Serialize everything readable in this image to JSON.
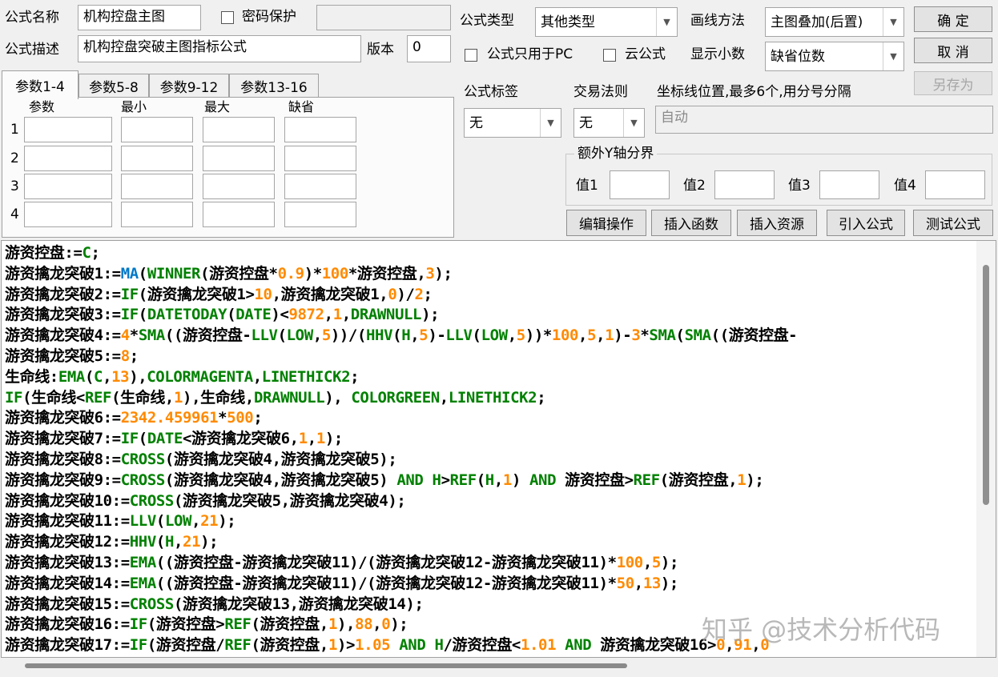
{
  "header": {
    "name_label": "公式名称",
    "name_value": "机构控盘主图",
    "password_label": "密码保护",
    "password_value": "",
    "desc_label": "公式描述",
    "desc_value": "机构控盘突破主图指标公式",
    "version_label": "版本",
    "version_value": "0"
  },
  "options": {
    "type_label": "公式类型",
    "type_value": "其他类型",
    "draw_label": "画线方法",
    "draw_value": "主图叠加(后置)",
    "pc_only_label": "公式只用于PC",
    "cloud_label": "云公式",
    "decimal_label": "显示小数",
    "decimal_value": "缺省位数",
    "tag_label": "公式标签",
    "tag_value": "无",
    "rule_label": "交易法则",
    "rule_value": "无",
    "axis_label": "坐标线位置,最多6个,用分号分隔",
    "axis_value": "自动",
    "yaxis_group": "额外Y轴分界",
    "y1": "值1",
    "y2": "值2",
    "y3": "值3",
    "y4": "值4"
  },
  "buttons": {
    "ok": "确 定",
    "cancel": "取 消",
    "save_as": "另存为",
    "edit": "编辑操作",
    "insert_func": "插入函数",
    "insert_res": "插入资源",
    "import": "引入公式",
    "test": "测试公式"
  },
  "params": {
    "tabs": [
      "参数1-4",
      "参数5-8",
      "参数9-12",
      "参数13-16"
    ],
    "active_tab": "参数1-4",
    "columns": [
      "参数",
      "最小",
      "最大",
      "缺省"
    ],
    "rows": [
      "1",
      "2",
      "3",
      "4"
    ]
  },
  "code_lines": [
    [
      [
        "p",
        "游资控盘:="
      ],
      [
        "f",
        "C"
      ],
      [
        "p",
        ";"
      ]
    ],
    [
      [
        "p",
        "游资擒龙突破1:="
      ],
      [
        "m",
        "MA"
      ],
      [
        "p",
        "("
      ],
      [
        "f",
        "WINNER"
      ],
      [
        "p",
        "(游资控盘*"
      ],
      [
        "n",
        "0.9"
      ],
      [
        "p",
        ")*"
      ],
      [
        "n",
        "100"
      ],
      [
        "p",
        "*游资控盘,"
      ],
      [
        "n",
        "3"
      ],
      [
        "p",
        ");"
      ]
    ],
    [
      [
        "p",
        "游资擒龙突破2:="
      ],
      [
        "f",
        "IF"
      ],
      [
        "p",
        "(游资擒龙突破1>"
      ],
      [
        "n",
        "10"
      ],
      [
        "p",
        ",游资擒龙突破1,"
      ],
      [
        "n",
        "0"
      ],
      [
        "p",
        ")/"
      ],
      [
        "n",
        "2"
      ],
      [
        "p",
        ";"
      ]
    ],
    [
      [
        "p",
        "游资擒龙突破3:="
      ],
      [
        "f",
        "IF"
      ],
      [
        "p",
        "("
      ],
      [
        "f",
        "DATETODAY"
      ],
      [
        "p",
        "("
      ],
      [
        "f",
        "DATE"
      ],
      [
        "p",
        ")<"
      ],
      [
        "n",
        "9872"
      ],
      [
        "p",
        ","
      ],
      [
        "n",
        "1"
      ],
      [
        "p",
        ","
      ],
      [
        "f",
        "DRAWNULL"
      ],
      [
        "p",
        ");"
      ]
    ],
    [
      [
        "p",
        "游资擒龙突破4:="
      ],
      [
        "n",
        "4"
      ],
      [
        "p",
        "*"
      ],
      [
        "f",
        "SMA"
      ],
      [
        "p",
        "((游资控盘-"
      ],
      [
        "f",
        "LLV"
      ],
      [
        "p",
        "("
      ],
      [
        "f",
        "LOW"
      ],
      [
        "p",
        ","
      ],
      [
        "n",
        "5"
      ],
      [
        "p",
        "))/("
      ],
      [
        "f",
        "HHV"
      ],
      [
        "p",
        "("
      ],
      [
        "f",
        "H"
      ],
      [
        "p",
        ","
      ],
      [
        "n",
        "5"
      ],
      [
        "p",
        ")-"
      ],
      [
        "f",
        "LLV"
      ],
      [
        "p",
        "("
      ],
      [
        "f",
        "LOW"
      ],
      [
        "p",
        ","
      ],
      [
        "n",
        "5"
      ],
      [
        "p",
        "))*"
      ],
      [
        "n",
        "100"
      ],
      [
        "p",
        ","
      ],
      [
        "n",
        "5"
      ],
      [
        "p",
        ","
      ],
      [
        "n",
        "1"
      ],
      [
        "p",
        ")-"
      ],
      [
        "n",
        "3"
      ],
      [
        "p",
        "*"
      ],
      [
        "f",
        "SMA"
      ],
      [
        "p",
        "("
      ],
      [
        "f",
        "SMA"
      ],
      [
        "p",
        "((游资控盘-"
      ]
    ],
    [
      [
        "p",
        "游资擒龙突破5:="
      ],
      [
        "n",
        "8"
      ],
      [
        "p",
        ";"
      ]
    ],
    [
      [
        "p",
        "生命线:"
      ],
      [
        "f",
        "EMA"
      ],
      [
        "p",
        "("
      ],
      [
        "f",
        "C"
      ],
      [
        "p",
        ","
      ],
      [
        "n",
        "13"
      ],
      [
        "p",
        "),"
      ],
      [
        "f",
        "COLORMAGENTA"
      ],
      [
        "p",
        ","
      ],
      [
        "f",
        "LINETHICK2"
      ],
      [
        "p",
        ";"
      ]
    ],
    [
      [
        "f",
        "IF"
      ],
      [
        "p",
        "(生命线<"
      ],
      [
        "f",
        "REF"
      ],
      [
        "p",
        "(生命线,"
      ],
      [
        "n",
        "1"
      ],
      [
        "p",
        "),生命线,"
      ],
      [
        "f",
        "DRAWNULL"
      ],
      [
        "p",
        "), "
      ],
      [
        "f",
        "COLORGREEN"
      ],
      [
        "p",
        ","
      ],
      [
        "f",
        "LINETHICK2"
      ],
      [
        "p",
        ";"
      ]
    ],
    [
      [
        "p",
        "游资擒龙突破6:="
      ],
      [
        "n",
        "2342.459961"
      ],
      [
        "p",
        "*"
      ],
      [
        "n",
        "500"
      ],
      [
        "p",
        ";"
      ]
    ],
    [
      [
        "p",
        "游资擒龙突破7:="
      ],
      [
        "f",
        "IF"
      ],
      [
        "p",
        "("
      ],
      [
        "f",
        "DATE"
      ],
      [
        "p",
        "<游资擒龙突破6,"
      ],
      [
        "n",
        "1"
      ],
      [
        "p",
        ","
      ],
      [
        "n",
        "1"
      ],
      [
        "p",
        ");"
      ]
    ],
    [
      [
        "p",
        "游资擒龙突破8:="
      ],
      [
        "f",
        "CROSS"
      ],
      [
        "p",
        "(游资擒龙突破4,游资擒龙突破5);"
      ]
    ],
    [
      [
        "p",
        "游资擒龙突破9:="
      ],
      [
        "f",
        "CROSS"
      ],
      [
        "p",
        "(游资擒龙突破4,游资擒龙突破5) "
      ],
      [
        "f",
        "AND"
      ],
      [
        "p",
        " "
      ],
      [
        "f",
        "H"
      ],
      [
        "p",
        ">"
      ],
      [
        "f",
        "REF"
      ],
      [
        "p",
        "("
      ],
      [
        "f",
        "H"
      ],
      [
        "p",
        ","
      ],
      [
        "n",
        "1"
      ],
      [
        "p",
        ") "
      ],
      [
        "f",
        "AND"
      ],
      [
        "p",
        " 游资控盘>"
      ],
      [
        "f",
        "REF"
      ],
      [
        "p",
        "(游资控盘,"
      ],
      [
        "n",
        "1"
      ],
      [
        "p",
        ");"
      ]
    ],
    [
      [
        "p",
        "游资擒龙突破10:="
      ],
      [
        "f",
        "CROSS"
      ],
      [
        "p",
        "(游资擒龙突破5,游资擒龙突破4);"
      ]
    ],
    [
      [
        "p",
        "游资擒龙突破11:="
      ],
      [
        "f",
        "LLV"
      ],
      [
        "p",
        "("
      ],
      [
        "f",
        "LOW"
      ],
      [
        "p",
        ","
      ],
      [
        "n",
        "21"
      ],
      [
        "p",
        ");"
      ]
    ],
    [
      [
        "p",
        "游资擒龙突破12:="
      ],
      [
        "f",
        "HHV"
      ],
      [
        "p",
        "("
      ],
      [
        "f",
        "H"
      ],
      [
        "p",
        ","
      ],
      [
        "n",
        "21"
      ],
      [
        "p",
        ");"
      ]
    ],
    [
      [
        "p",
        "游资擒龙突破13:="
      ],
      [
        "f",
        "EMA"
      ],
      [
        "p",
        "((游资控盘-游资擒龙突破11)/(游资擒龙突破12-游资擒龙突破11)*"
      ],
      [
        "n",
        "100"
      ],
      [
        "p",
        ","
      ],
      [
        "n",
        "5"
      ],
      [
        "p",
        ");"
      ]
    ],
    [
      [
        "p",
        "游资擒龙突破14:="
      ],
      [
        "f",
        "EMA"
      ],
      [
        "p",
        "((游资控盘-游资擒龙突破11)/(游资擒龙突破12-游资擒龙突破11)*"
      ],
      [
        "n",
        "50"
      ],
      [
        "p",
        ","
      ],
      [
        "n",
        "13"
      ],
      [
        "p",
        ");"
      ]
    ],
    [
      [
        "p",
        "游资擒龙突破15:="
      ],
      [
        "f",
        "CROSS"
      ],
      [
        "p",
        "(游资擒龙突破13,游资擒龙突破14);"
      ]
    ],
    [
      [
        "p",
        "游资擒龙突破16:="
      ],
      [
        "f",
        "IF"
      ],
      [
        "p",
        "(游资控盘>"
      ],
      [
        "f",
        "REF"
      ],
      [
        "p",
        "(游资控盘,"
      ],
      [
        "n",
        "1"
      ],
      [
        "p",
        "),"
      ],
      [
        "n",
        "88"
      ],
      [
        "p",
        ","
      ],
      [
        "n",
        "0"
      ],
      [
        "p",
        ");"
      ]
    ],
    [
      [
        "p",
        "游资擒龙突破17:="
      ],
      [
        "f",
        "IF"
      ],
      [
        "p",
        "(游资控盘/"
      ],
      [
        "f",
        "REF"
      ],
      [
        "p",
        "(游资控盘,"
      ],
      [
        "n",
        "1"
      ],
      [
        "p",
        ")>"
      ],
      [
        "n",
        "1.05"
      ],
      [
        "p",
        " "
      ],
      [
        "f",
        "AND"
      ],
      [
        "p",
        " "
      ],
      [
        "f",
        "H"
      ],
      [
        "p",
        "/游资控盘<"
      ],
      [
        "n",
        "1.01"
      ],
      [
        "p",
        " "
      ],
      [
        "f",
        "AND"
      ],
      [
        "p",
        " 游资擒龙突破16>"
      ],
      [
        "n",
        "0"
      ],
      [
        "p",
        ","
      ],
      [
        "n",
        "91"
      ],
      [
        "p",
        ","
      ],
      [
        "n",
        "0"
      ]
    ]
  ],
  "watermark": "知乎 @技术分析代码",
  "colors": {
    "function": "#008000",
    "keyword_ma": "#0078c8",
    "number": "#ff8a00",
    "plain": "#000000"
  }
}
